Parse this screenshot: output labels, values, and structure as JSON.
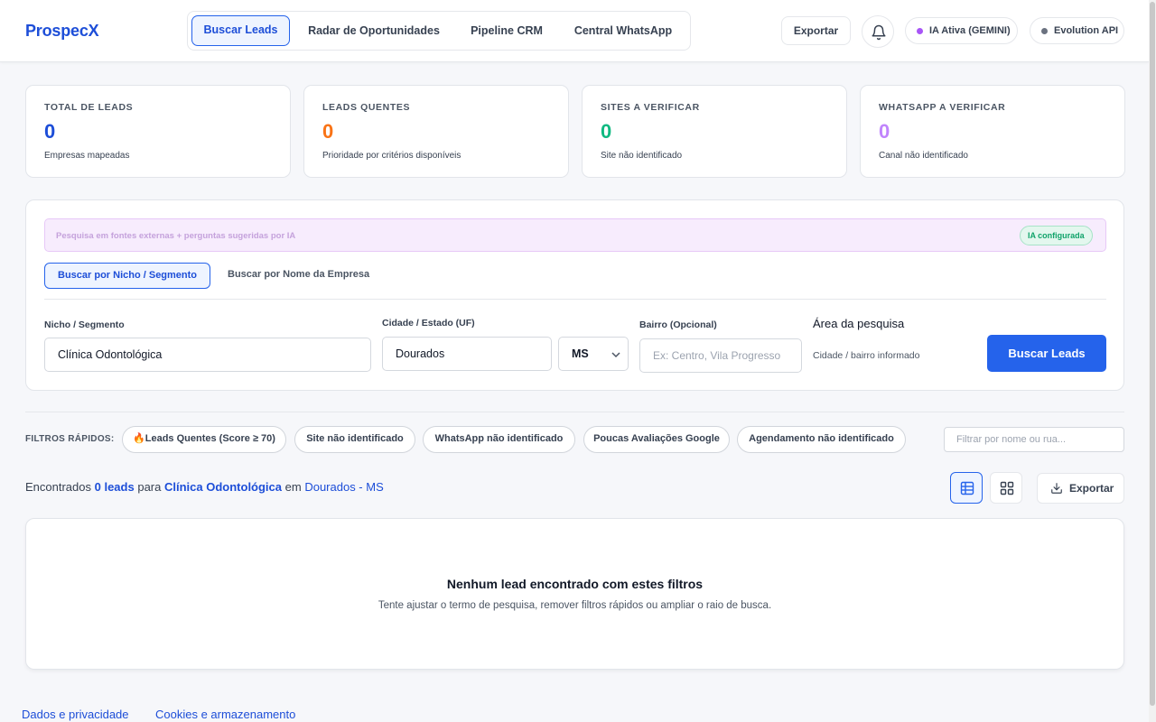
{
  "app": {
    "logo": "ProspecX"
  },
  "nav": {
    "tabs": [
      {
        "label": "Buscar Leads",
        "active": true
      },
      {
        "label": "Radar de Oportunidades",
        "active": false
      },
      {
        "label": "Pipeline CRM",
        "active": false
      },
      {
        "label": "Central WhatsApp",
        "active": false
      }
    ]
  },
  "header": {
    "export_label": "Exportar",
    "ai_status": "IA Ativa (GEMINI)",
    "evolution_status": "Evolution API",
    "colors": {
      "ai_dot": "#a855f7",
      "evolution_dot": "#6b7280"
    }
  },
  "stats": [
    {
      "label": "TOTAL DE LEADS",
      "value": "0",
      "sub": "Empresas mapeadas",
      "color": "#1d4ed8"
    },
    {
      "label": "LEADS QUENTES",
      "value": "0",
      "sub": "Prioridade por critérios disponíveis",
      "color": "#f97316"
    },
    {
      "label": "SITES A VERIFICAR",
      "value": "0",
      "sub": "Site não identificado",
      "color": "#10b981"
    },
    {
      "label": "WHATSAPP A VERIFICAR",
      "value": "0",
      "sub": "Canal não identificado",
      "color": "#c084fc"
    }
  ],
  "search": {
    "ai_banner": "Pesquisa em fontes externas + perguntas sugeridas por IA",
    "ai_badge": "IA configurada",
    "tabs": [
      {
        "label": "Buscar por Nicho / Segmento",
        "active": true
      },
      {
        "label": "Buscar por Nome da Empresa",
        "active": false
      }
    ],
    "niche_label": "Nicho / Segmento",
    "niche_value": "Clínica Odontológica",
    "city_label": "Cidade / Estado (UF)",
    "city_value": "Dourados",
    "state_value": "MS",
    "neighborhood_label": "Bairro (Opcional)",
    "neighborhood_placeholder": "Ex: Centro, Vila Progresso",
    "area_title": "Área da pesquisa",
    "area_sub": "Cidade / bairro informado",
    "submit_label": "Buscar Leads"
  },
  "quick_filters": {
    "label": "FILTROS RÁPIDOS:",
    "chips": [
      "🔥Leads Quentes (Score ≥ 70)",
      "Site não identificado",
      "WhatsApp não identificado",
      "Poucas Avaliações Google",
      "Agendamento não identificado"
    ],
    "filter_placeholder": "Filtrar por nome ou rua..."
  },
  "results": {
    "prefix": "Encontrados",
    "count": "0 leads",
    "for_word": "para",
    "niche": "Clínica Odontológica",
    "in_word": "em",
    "location": "Dourados - MS",
    "export_label": "Exportar"
  },
  "empty_state": {
    "title": "Nenhum lead encontrado com estes filtros",
    "subtitle": "Tente ajustar o termo de pesquisa, remover filtros rápidos ou ampliar o raio de busca."
  },
  "footer": {
    "links": [
      "Dados e privacidade",
      "Cookies e armazenamento"
    ]
  }
}
